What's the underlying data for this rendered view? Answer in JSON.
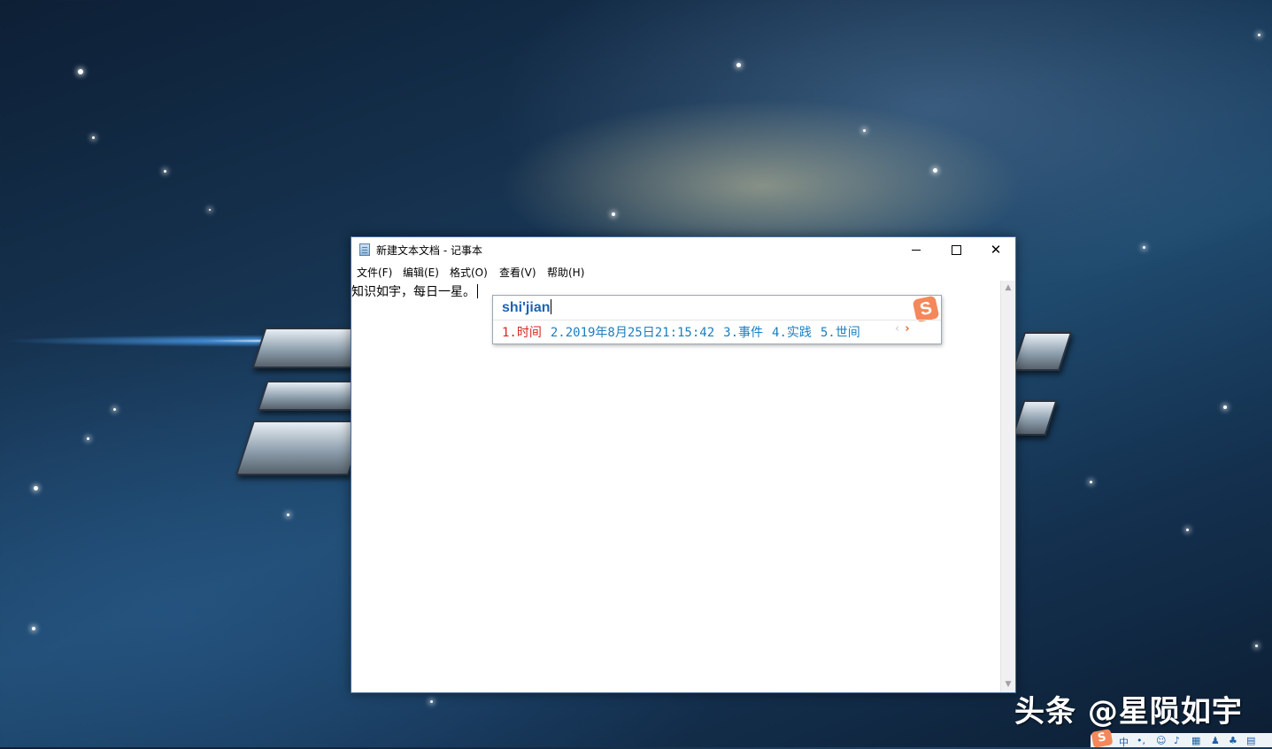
{
  "window": {
    "title": "新建文本文档 - 记事本"
  },
  "menu": {
    "items": [
      {
        "label": "文件(F)"
      },
      {
        "label": "编辑(E)"
      },
      {
        "label": "格式(O)"
      },
      {
        "label": "查看(V)"
      },
      {
        "label": "帮助(H)"
      }
    ]
  },
  "editor": {
    "content": "知识如宇，每日一星。"
  },
  "ime": {
    "input": "shi'jian",
    "candidates": [
      {
        "label": "1.时间"
      },
      {
        "label": "2.2019年8月25日21:15:42"
      },
      {
        "label": "3.事件"
      },
      {
        "label": "4.实践"
      },
      {
        "label": "5.世间"
      }
    ],
    "prev_icon": "‹",
    "next_icon": "›",
    "logo_letter": "S",
    "colors": {
      "selected": "#d42a1a",
      "candidate": "#1a7fbf",
      "input": "#1e63b5",
      "logo": "#f4885a"
    }
  },
  "watermark": "头条 @星陨如宇",
  "ime_status": {
    "logo_letter": "S",
    "mode": "中"
  }
}
